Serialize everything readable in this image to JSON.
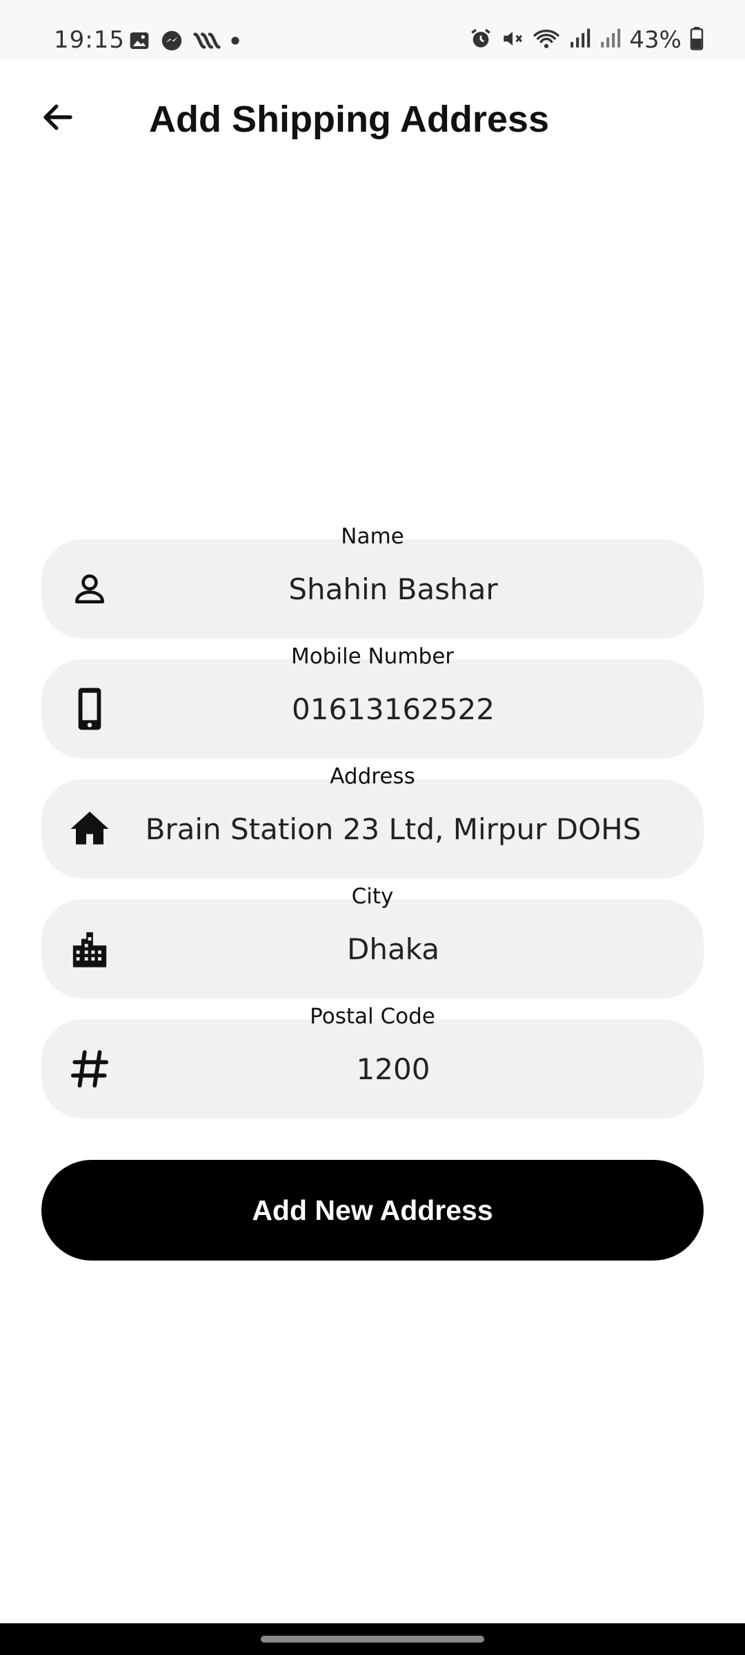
{
  "status_bar": {
    "time": "19:15",
    "battery": "43%",
    "left_icons": [
      "gallery-icon",
      "messenger-icon",
      "app-icon",
      "dot-icon"
    ],
    "right_icons": [
      "alarm-icon",
      "mute-icon",
      "wifi-icon",
      "signal-icon",
      "signal-icon",
      "battery-icon"
    ]
  },
  "header": {
    "title": "Add Shipping Address",
    "back_icon": "arrow-left-icon"
  },
  "form": {
    "fields": [
      {
        "label": "Name",
        "value": "Shahin Bashar",
        "icon": "person-icon"
      },
      {
        "label": "Mobile Number",
        "value": "01613162522",
        "icon": "phone-icon"
      },
      {
        "label": "Address",
        "value": "Brain Station 23 Ltd, Mirpur DOHS",
        "icon": "home-icon"
      },
      {
        "label": "City",
        "value": "Dhaka",
        "icon": "city-icon"
      },
      {
        "label": "Postal Code",
        "value": "1200",
        "icon": "hash-icon"
      }
    ],
    "submit_label": "Add New Address"
  },
  "colors": {
    "field_background": "#f1f1f1",
    "button_background": "#000000",
    "button_text": "#ffffff"
  }
}
